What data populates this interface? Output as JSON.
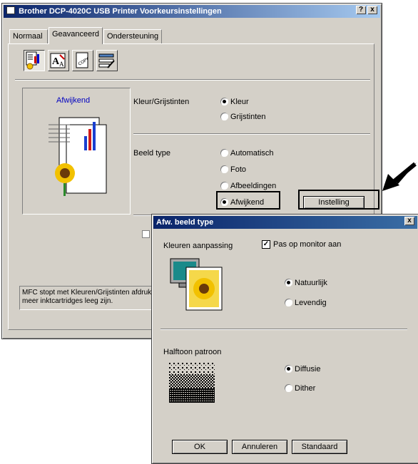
{
  "main": {
    "title": "Brother DCP-4020C USB Printer Voorkeursinstellingen",
    "help_button": "?",
    "close_button": "x",
    "tabs": [
      "Normaal",
      "Geavanceerd",
      "Ondersteuning"
    ],
    "preview_label": "Afwijkend",
    "color_group_label": "Kleur/Grijstinten",
    "color_options": [
      "Kleur",
      "Grijstinten"
    ],
    "color_selected": "Kleur",
    "image_type_label": "Beeld type",
    "image_type_options": [
      "Automatisch",
      "Foto",
      "Afbeeldingen",
      "Afwijkend"
    ],
    "image_type_selected": "Afwijkend",
    "settings_button": "Instelling",
    "info_text_line1": "MFC stopt met Kleuren/Grijstinten afdruk",
    "info_text_line2": "meer inktcartridges leeg zijn."
  },
  "dialog": {
    "title": "Afw. beeld type",
    "close_button": "x",
    "color_adjust_label": "Kleuren aanpassing",
    "monitor_checkbox_label": "Pas op monitor aan",
    "monitor_checked": true,
    "color_options": [
      "Natuurlijk",
      "Levendig"
    ],
    "color_selected": "Natuurlijk",
    "halftone_label": "Halftoon patroon",
    "halftone_options": [
      "Diffusie",
      "Dither"
    ],
    "halftone_selected": "Diffusie",
    "ok_button": "OK",
    "cancel_button": "Annuleren",
    "default_button": "Standaard"
  },
  "colors": {
    "title_dark": "#0a246a",
    "title_light": "#a6caf0",
    "face": "#d4d0c8",
    "link_blue": "#0000c0"
  },
  "icons": [
    "page-layout-icon",
    "text-icon",
    "copy-icon",
    "settings-icon",
    "sunflower-icon",
    "monitor-icon",
    "halftone-icon",
    "arrow-icon"
  ]
}
